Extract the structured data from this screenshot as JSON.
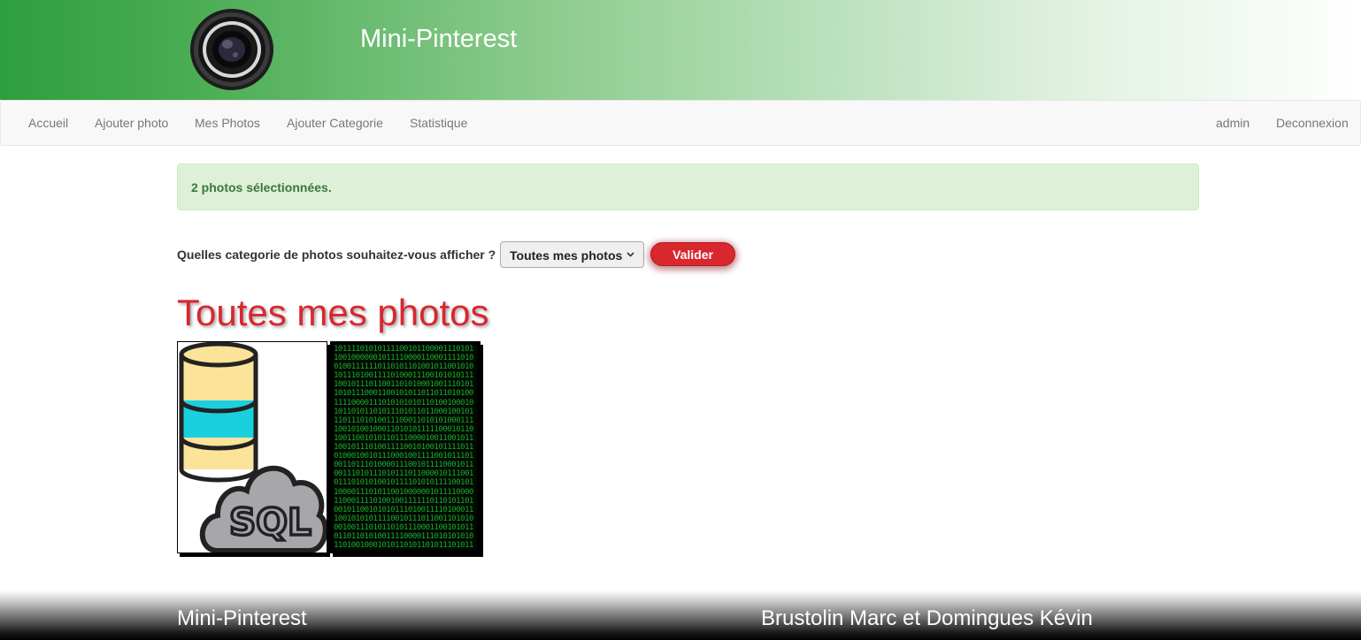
{
  "header": {
    "site_title": "Mini-Pinterest",
    "logo_icon": "camera-lens-icon"
  },
  "nav": {
    "left": [
      {
        "label": "Accueil"
      },
      {
        "label": "Ajouter photo"
      },
      {
        "label": "Mes Photos"
      },
      {
        "label": "Ajouter Categorie"
      },
      {
        "label": "Statistique"
      }
    ],
    "right": [
      {
        "label": "admin"
      },
      {
        "label": "Deconnexion"
      }
    ]
  },
  "alert": {
    "message": "2 photos sélectionnées."
  },
  "filter": {
    "label": "Quelles categorie de photos souhaitez-vous afficher ?",
    "selected_option": "Toutes mes photos",
    "submit_label": "Valider"
  },
  "section": {
    "title": "Toutes mes photos"
  },
  "photos": [
    {
      "icon": "sql-database-cloud-icon"
    },
    {
      "icon": "binary-code-icon"
    }
  ],
  "footer": {
    "left_text": "Mini-Pinterest",
    "right_text": "Brustolin Marc et Domingues Kévin"
  },
  "colors": {
    "header_green": "#2e9e3e",
    "accent_red": "#d9272e",
    "alert_bg": "#dff0d8",
    "alert_text": "#3c763d",
    "nav_text": "#777777"
  }
}
